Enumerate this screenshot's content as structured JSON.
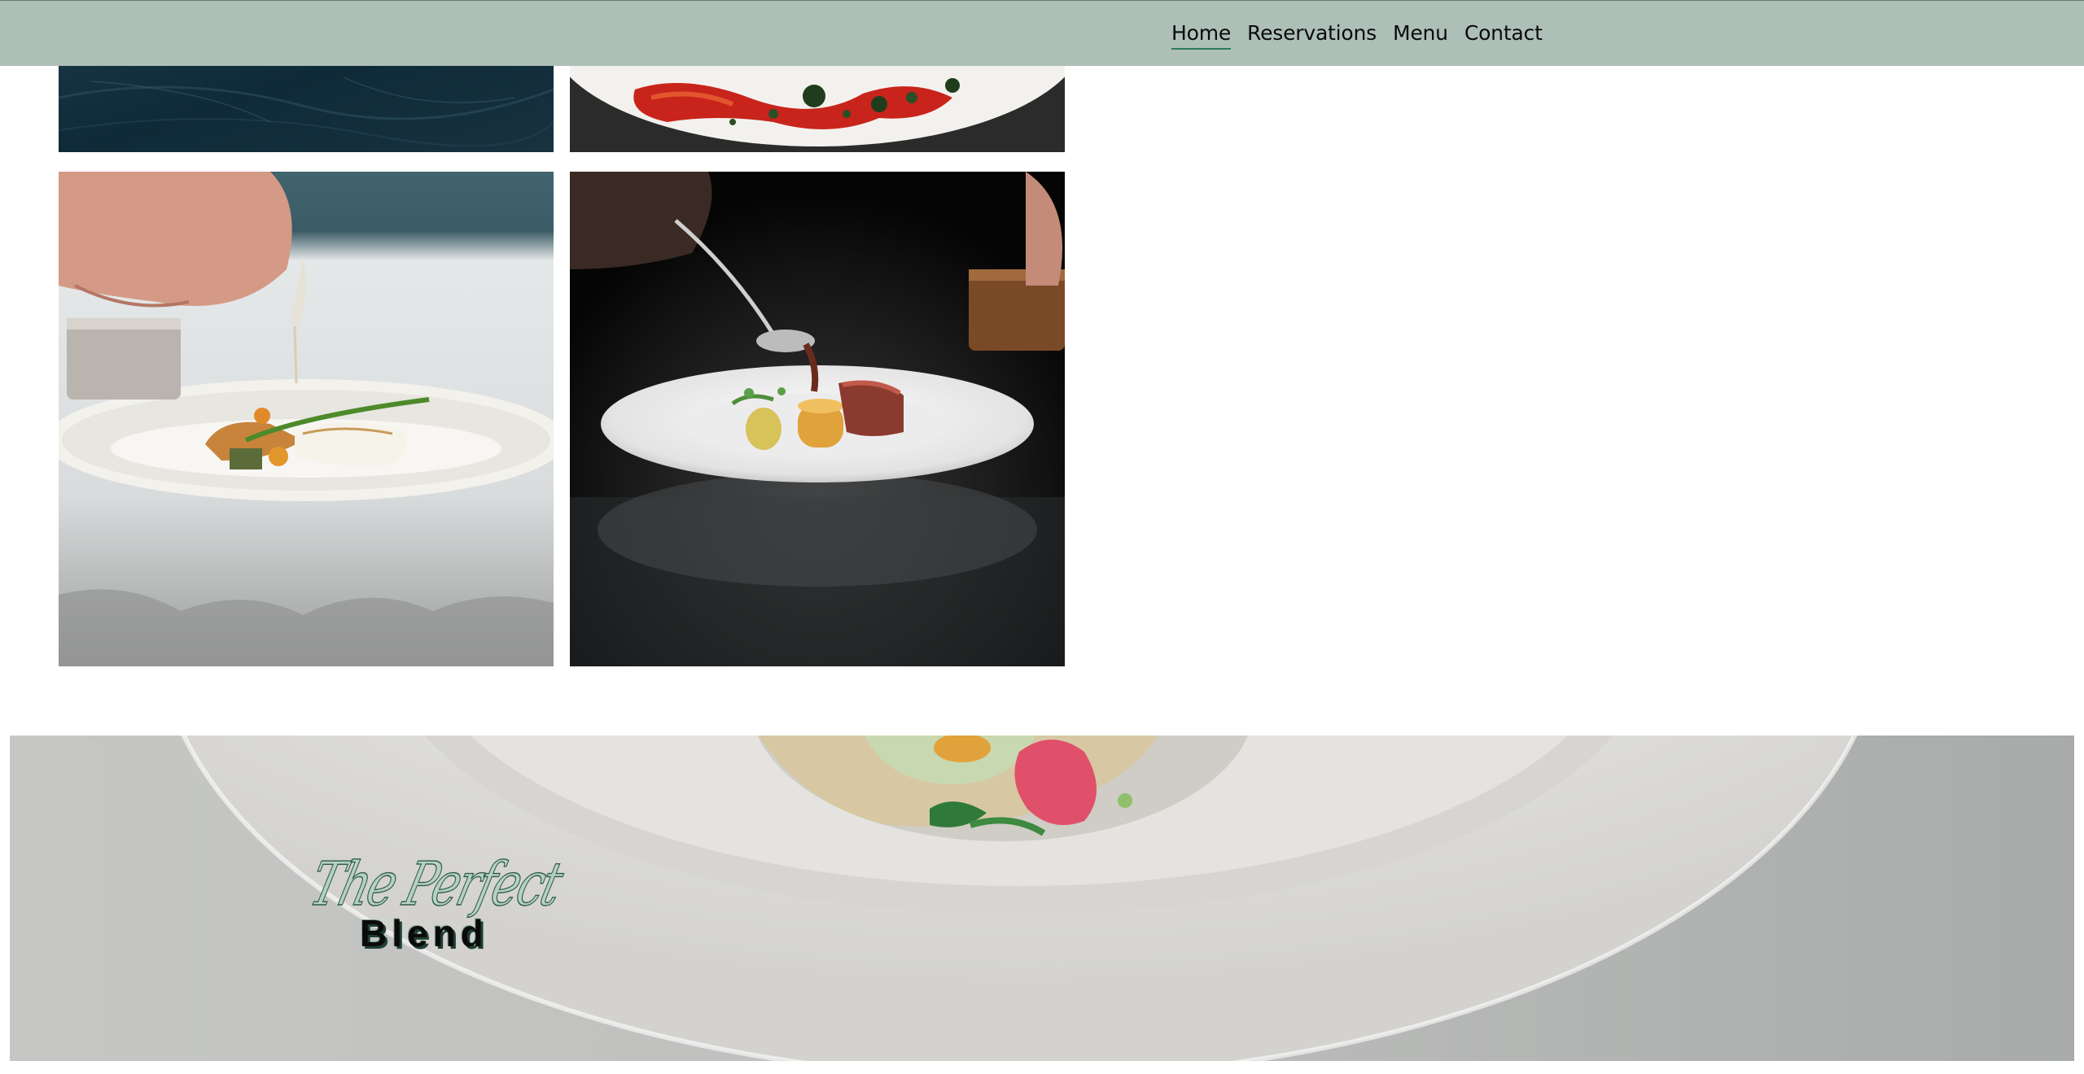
{
  "header": {
    "nav": [
      {
        "label": "Home",
        "active": true
      },
      {
        "label": "Reservations",
        "active": false
      },
      {
        "label": "Menu",
        "active": false
      },
      {
        "label": "Contact",
        "active": false
      }
    ],
    "background_color": "#adbfb7",
    "active_underline_color": "#2e7a60"
  },
  "gallery": {
    "images": [
      {
        "name": "dark-textured-plate-photo",
        "visible": "partially cropped"
      },
      {
        "name": "red-sauce-dish-photo",
        "visible": "partially cropped"
      },
      {
        "name": "chef-pouring-sauce-white-fish-photo",
        "visible": "full"
      },
      {
        "name": "chef-pouring-sauce-dark-plate-photo",
        "visible": "full"
      }
    ]
  },
  "hero": {
    "logo": {
      "script_text": "The Perfect",
      "bold_text": "Blend",
      "script_color": "#b6d1c3"
    }
  }
}
